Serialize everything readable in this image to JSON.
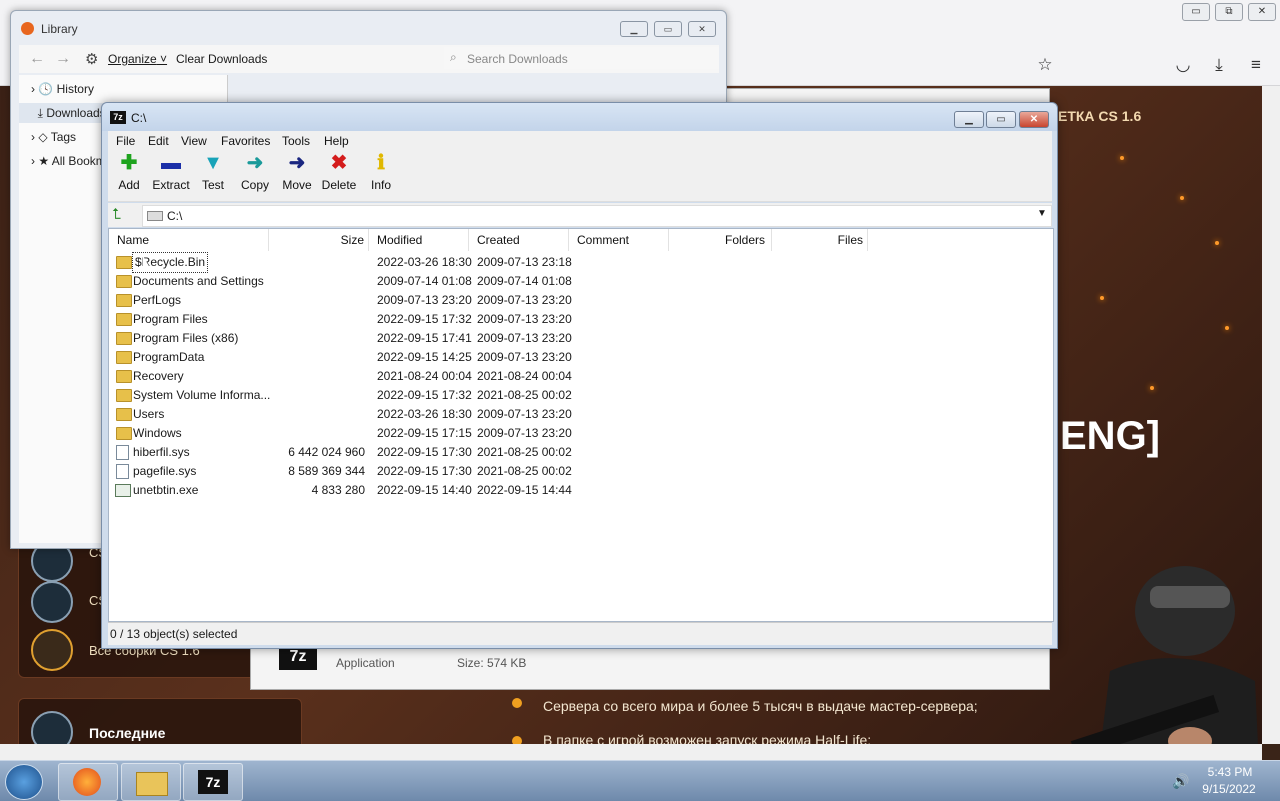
{
  "browser": {
    "controls": {
      "minimize": "▭",
      "restore": "⧉",
      "close": "✕"
    },
    "toolbar_icons": [
      "star-icon",
      "pocket-icon",
      "download-icon",
      "menu-icon"
    ],
    "page": {
      "top_right_text": "ЕТКА CS 1.6",
      "eng_text": "ENG]",
      "side_items": [
        {
          "label": "CS"
        },
        {
          "label": "CS"
        },
        {
          "label": "Все сборки CS 1.6"
        }
      ],
      "last_label": "Последние",
      "bullets": [
        "Сервера со всего мира и более 5 тысяч в выдаче мастер-сервера;",
        "В папке с игрой возможен запуск режима Half-Life;"
      ]
    }
  },
  "library": {
    "title": "Library",
    "organize": "Organize",
    "clear": "Clear Downloads",
    "search_placeholder": "Search Downloads",
    "tree": [
      "History",
      "Downloads",
      "Tags",
      "All Bookmarks"
    ]
  },
  "download_panel": {
    "app_label": "Application",
    "size_label": "Size: 574 KB"
  },
  "zip": {
    "title": "C:\\",
    "menus": [
      "File",
      "Edit",
      "View",
      "Favorites",
      "Tools",
      "Help"
    ],
    "tools": [
      {
        "label": "Add",
        "icon": "plus-icon",
        "color": "#1ea31e"
      },
      {
        "label": "Extract",
        "icon": "minus-icon",
        "color": "#1b2fa8"
      },
      {
        "label": "Test",
        "icon": "check-icon",
        "color": "#18a3b8"
      },
      {
        "label": "Copy",
        "icon": "arrow-right-icon",
        "color": "#1a9a9a"
      },
      {
        "label": "Move",
        "icon": "arrow-right-icon",
        "color": "#1a2680"
      },
      {
        "label": "Delete",
        "icon": "x-icon",
        "color": "#d41c1c"
      },
      {
        "label": "Info",
        "icon": "info-icon",
        "color": "#e0b800"
      }
    ],
    "address": "C:\\",
    "columns": [
      "Name",
      "Size",
      "Modified",
      "Created",
      "Comment",
      "Folders",
      "Files"
    ],
    "rows": [
      {
        "name": "$Recycle.Bin",
        "size": "",
        "modified": "2022-03-26 18:30",
        "created": "2009-07-13 23:18",
        "type": "folder"
      },
      {
        "name": "Documents and Settings",
        "size": "",
        "modified": "2009-07-14 01:08",
        "created": "2009-07-14 01:08",
        "type": "folder"
      },
      {
        "name": "PerfLogs",
        "size": "",
        "modified": "2009-07-13 23:20",
        "created": "2009-07-13 23:20",
        "type": "folder"
      },
      {
        "name": "Program Files",
        "size": "",
        "modified": "2022-09-15 17:32",
        "created": "2009-07-13 23:20",
        "type": "folder"
      },
      {
        "name": "Program Files (x86)",
        "size": "",
        "modified": "2022-09-15 17:41",
        "created": "2009-07-13 23:20",
        "type": "folder"
      },
      {
        "name": "ProgramData",
        "size": "",
        "modified": "2022-09-15 14:25",
        "created": "2009-07-13 23:20",
        "type": "folder"
      },
      {
        "name": "Recovery",
        "size": "",
        "modified": "2021-08-24 00:04",
        "created": "2021-08-24 00:04",
        "type": "folder"
      },
      {
        "name": "System Volume Informa...",
        "size": "",
        "modified": "2022-09-15 17:32",
        "created": "2021-08-25 00:02",
        "type": "folder"
      },
      {
        "name": "Users",
        "size": "",
        "modified": "2022-03-26 18:30",
        "created": "2009-07-13 23:20",
        "type": "folder"
      },
      {
        "name": "Windows",
        "size": "",
        "modified": "2022-09-15 17:15",
        "created": "2009-07-13 23:20",
        "type": "folder"
      },
      {
        "name": "hiberfil.sys",
        "size": "6 442 024 960",
        "modified": "2022-09-15 17:30",
        "created": "2021-08-25 00:02",
        "type": "file"
      },
      {
        "name": "pagefile.sys",
        "size": "8 589 369 344",
        "modified": "2022-09-15 17:30",
        "created": "2021-08-25 00:02",
        "type": "file"
      },
      {
        "name": "unetbtin.exe",
        "size": "4 833 280",
        "modified": "2022-09-15 14:40",
        "created": "2022-09-15 14:44",
        "type": "exe"
      }
    ],
    "status": "0 / 13 object(s) selected"
  },
  "taskbar": {
    "time": "5:43 PM",
    "date": "9/15/2022",
    "apps": [
      "firefox-icon",
      "explorer-icon",
      "7zip-icon"
    ]
  }
}
